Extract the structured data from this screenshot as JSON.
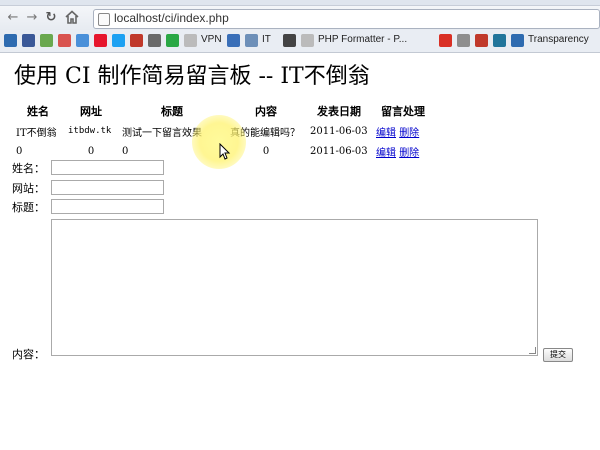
{
  "browser": {
    "url": "localhost/ci/index.php",
    "bookmarks": [
      {
        "label": "",
        "icon": "globe-icon",
        "color": "#2e6bb0"
      },
      {
        "label": "",
        "icon": "photo-icon",
        "color": "#3b5998"
      },
      {
        "label": "",
        "icon": "puzzle-icon",
        "color": "#6aa84f"
      },
      {
        "label": "",
        "icon": "bookmark-icon",
        "color": "#d9534f"
      },
      {
        "label": "",
        "icon": "cloud-icon",
        "color": "#4a90d9"
      },
      {
        "label": "",
        "icon": "weibo-icon",
        "color": "#e6162d"
      },
      {
        "label": "",
        "icon": "bird-icon",
        "color": "#1da1f2"
      },
      {
        "label": "",
        "icon": "red-circle-icon",
        "color": "#c0392b"
      },
      {
        "label": "",
        "icon": "camera-icon",
        "color": "#6a6a6a"
      },
      {
        "label": "",
        "icon": "flag-icon",
        "color": "#2aa845"
      },
      {
        "label": "VPN",
        "icon": "page-icon",
        "color": "#bbbbbb"
      },
      {
        "label": "",
        "icon": "grid-icon",
        "color": "#3a6fb8"
      },
      {
        "label": "IT",
        "icon": "it-icon",
        "color": "#6d8fb8"
      },
      {
        "label": "",
        "icon": "terminal-icon",
        "color": "#444444"
      },
      {
        "label": "PHP Formatter - P...",
        "icon": "page-icon",
        "color": "#bbbbbb"
      },
      {
        "label": "",
        "icon": "gmail-icon",
        "color": "#d93025"
      },
      {
        "label": "",
        "icon": "box-icon",
        "color": "#8e8e8e"
      },
      {
        "label": "",
        "icon": "w-icon",
        "color": "#c0392b"
      },
      {
        "label": "",
        "icon": "wordpress-icon",
        "color": "#21759b"
      },
      {
        "label": "Transparency",
        "icon": "globe-icon",
        "color": "#2e6bb0"
      }
    ]
  },
  "page": {
    "title": "使用 CI 制作简易留言板 -- IT不倒翁",
    "table": {
      "headers": [
        "姓名",
        "网址",
        "标题",
        "内容",
        "发表日期",
        "留言处理"
      ],
      "rows": [
        {
          "name": "IT不倒翁",
          "url": "itbdw.tk",
          "title": "测试一下留言效果",
          "content": "真的能编辑吗？",
          "date": "2011-06-03",
          "edit": "编辑",
          "delete": "删除"
        },
        {
          "name": "0",
          "url": "0",
          "title": "0",
          "content": "0",
          "date": "2011-06-03",
          "edit": "编辑",
          "delete": "删除"
        }
      ]
    },
    "form": {
      "name_label": "姓名：",
      "site_label": "网站：",
      "title_label": "标题：",
      "content_label": "内容：",
      "name_value": "",
      "site_value": "",
      "title_value": "",
      "content_value": "",
      "submit_label": "提交"
    }
  }
}
